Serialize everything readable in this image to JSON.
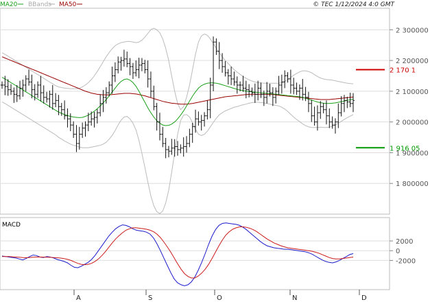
{
  "header": {
    "legend": [
      {
        "label": "MA20",
        "color": "#1aa01a"
      },
      {
        "label": "BBands",
        "color": "#aaaaaa"
      },
      {
        "label": "MA50",
        "color": "#990000"
      }
    ],
    "copyright": "© TEC 1/12/2024 4:0 GMT"
  },
  "chart_data": [
    {
      "type": "ohlc",
      "title": "",
      "y_ticks": [
        "2 300000",
        "2 200000",
        "2 100000",
        "2 000000",
        "1 900000",
        "1 800000"
      ],
      "y_tick_values": [
        2300,
        2200,
        2100,
        2000,
        1900,
        1800
      ],
      "ylim": [
        1700,
        2370
      ],
      "x_ticks": [
        "A",
        "S",
        "O",
        "N",
        "D"
      ],
      "markers": [
        {
          "label": "2 170 1",
          "value": 2170.1,
          "color": "#cc0000"
        },
        {
          "label": "1 916 05",
          "value": 1916.05,
          "color": "#009900"
        }
      ],
      "series": [
        {
          "name": "MA20",
          "color": "#1aa01a"
        },
        {
          "name": "BBands",
          "color": "#aaaaaa"
        },
        {
          "name": "MA50",
          "color": "#990000"
        }
      ],
      "close": [
        2120,
        2115,
        2105,
        2100,
        2090,
        2085,
        2110,
        2120,
        2140,
        2130,
        2105,
        2090,
        2120,
        2095,
        2080,
        2075,
        2090,
        2060,
        2070,
        2050,
        2040,
        2020,
        2010,
        1990,
        1960,
        1930,
        1960,
        1980,
        1990,
        2000,
        2010,
        2015,
        2030,
        2060,
        2080,
        2095,
        2120,
        2150,
        2170,
        2195,
        2200,
        2205,
        2190,
        2180,
        2160,
        2170,
        2185,
        2190,
        2170,
        2140,
        2100,
        2050,
        2000,
        1960,
        1930,
        1910,
        1905,
        1915,
        1920,
        1910,
        1915,
        1920,
        1930,
        1960,
        1985,
        2010,
        2000,
        2005,
        2020,
        2040,
        2120,
        2260,
        2230,
        2200,
        2180,
        2160,
        2150,
        2140,
        2130,
        2120,
        2120,
        2110,
        2105,
        2100,
        2095,
        2090,
        2110,
        2090,
        2080,
        2100,
        2095,
        2080,
        2100,
        2120,
        2130,
        2150,
        2140,
        2120,
        2110,
        2100,
        2110,
        2090,
        2080,
        2060,
        2020,
        2000,
        2030,
        2050,
        2040,
        2020,
        2000,
        1990,
        2000,
        2030,
        2060,
        2070,
        2065,
        2060,
        2070
      ],
      "ma20": [
        2145,
        2140,
        2134,
        2128,
        2122,
        2116,
        2110,
        2104,
        2098,
        2092,
        2086,
        2080,
        2074,
        2068,
        2062,
        2056,
        2050,
        2044,
        2038,
        2032,
        2028,
        2024,
        2021,
        2018,
        2016,
        2015,
        2014,
        2015,
        2018,
        2022,
        2028,
        2035,
        2043,
        2052,
        2062,
        2073,
        2085,
        2097,
        2110,
        2122,
        2132,
        2138,
        2140,
        2136,
        2128,
        2116,
        2100,
        2082,
        2064,
        2046,
        2030,
        2016,
        2004,
        1996,
        1990,
        1988,
        1989,
        1993,
        2000,
        2010,
        2022,
        2036,
        2052,
        2068,
        2084,
        2098,
        2110,
        2118,
        2123,
        2126,
        2127,
        2127,
        2126,
        2124,
        2121,
        2118,
        2115,
        2112,
        2109,
        2106,
        2104,
        2102,
        2100,
        2099,
        2098,
        2097,
        2096,
        2095,
        2094,
        2093,
        2092,
        2091,
        2090,
        2089,
        2088,
        2087,
        2086,
        2085,
        2084,
        2083,
        2082,
        2080,
        2077,
        2074,
        2071,
        2068,
        2065,
        2063,
        2061,
        2060,
        2060,
        2061,
        2062,
        2064,
        2066,
        2068,
        2070,
        2072,
        2074
      ],
      "ma50": [
        2212,
        2208,
        2204,
        2200,
        2196,
        2192,
        2188,
        2184,
        2180,
        2176,
        2172,
        2168,
        2164,
        2160,
        2156,
        2152,
        2148,
        2144,
        2140,
        2136,
        2132,
        2128,
        2124,
        2120,
        2116,
        2112,
        2108,
        2104,
        2100,
        2097,
        2094,
        2092,
        2090,
        2089,
        2088,
        2088,
        2088,
        2089,
        2090,
        2091,
        2092,
        2093,
        2093,
        2093,
        2092,
        2091,
        2089,
        2087,
        2085,
        2082,
        2079,
        2076,
        2073,
        2070,
        2067,
        2065,
        2063,
        2061,
        2060,
        2059,
        2058,
        2058,
        2058,
        2059,
        2060,
        2062,
        2064,
        2066,
        2068,
        2070,
        2072,
        2074,
        2076,
        2078,
        2080,
        2082,
        2083,
        2084,
        2085,
        2086,
        2087,
        2088,
        2089,
        2090,
        2090,
        2090,
        2090,
        2090,
        2090,
        2090,
        2090,
        2089,
        2088,
        2087,
        2086,
        2085,
        2084,
        2083,
        2082,
        2081,
        2080,
        2079,
        2078,
        2077,
        2076,
        2075,
        2074,
        2073,
        2073,
        2073,
        2073,
        2074,
        2075,
        2076,
        2077,
        2078,
        2079,
        2080,
        2081
      ],
      "bb_upper": [
        2225,
        2220,
        2214,
        2208,
        2202,
        2196,
        2190,
        2184,
        2178,
        2172,
        2166,
        2160,
        2154,
        2148,
        2142,
        2136,
        2130,
        2124,
        2118,
        2114,
        2112,
        2110,
        2109,
        2108,
        2108,
        2108,
        2110,
        2114,
        2120,
        2128,
        2138,
        2150,
        2164,
        2180,
        2196,
        2212,
        2226,
        2238,
        2248,
        2254,
        2258,
        2260,
        2262,
        2262,
        2260,
        2258,
        2260,
        2266,
        2276,
        2288,
        2300,
        2305,
        2300,
        2290,
        2270,
        2240,
        2200,
        2150,
        2100,
        2060,
        2040,
        2050,
        2080,
        2120,
        2170,
        2220,
        2260,
        2280,
        2286,
        2282,
        2270,
        2255,
        2240,
        2225,
        2212,
        2200,
        2190,
        2180,
        2170,
        2162,
        2155,
        2148,
        2142,
        2137,
        2133,
        2130,
        2128,
        2127,
        2126,
        2126,
        2126,
        2126,
        2126,
        2126,
        2128,
        2132,
        2138,
        2145,
        2152,
        2158,
        2163,
        2166,
        2166,
        2164,
        2160,
        2154,
        2148,
        2143,
        2140,
        2138,
        2137,
        2136,
        2134,
        2132,
        2130,
        2128,
        2126,
        2125,
        2124
      ],
      "bb_lower": [
        2065,
        2060,
        2054,
        2048,
        2042,
        2036,
        2030,
        2024,
        2018,
        2012,
        2006,
        2000,
        1994,
        1988,
        1982,
        1976,
        1970,
        1964,
        1958,
        1950,
        1944,
        1938,
        1933,
        1928,
        1924,
        1922,
        1918,
        1916,
        1916,
        1916,
        1918,
        1920,
        1922,
        1924,
        1928,
        1934,
        1944,
        1956,
        1972,
        1990,
        2006,
        2016,
        2018,
        2010,
        1996,
        1974,
        1940,
        1898,
        1852,
        1804,
        1760,
        1727,
        1708,
        1702,
        1710,
        1736,
        1778,
        1836,
        1900,
        1960,
        2004,
        2022,
        2024,
        2016,
        1998,
        1976,
        1960,
        1956,
        1960,
        1970,
        1984,
        1999,
        2012,
        2023,
        2030,
        2036,
        2040,
        2044,
        2048,
        2050,
        2053,
        2056,
        2058,
        2061,
        2063,
        2064,
        2064,
        2063,
        2062,
        2060,
        2058,
        2056,
        2054,
        2052,
        2048,
        2042,
        2034,
        2025,
        2016,
        2008,
        2001,
        1994,
        1988,
        1984,
        1982,
        1982,
        1982,
        1983,
        1982,
        1982,
        1983,
        1986,
        1990,
        1996,
        2002,
        2008,
        2014,
        2019,
        2024
      ]
    },
    {
      "type": "line",
      "title": "MACD",
      "y_ticks": [
        "2000",
        "0",
        "-2000"
      ],
      "y_tick_values": [
        2000,
        0,
        -2000
      ],
      "ylim": [
        -8000,
        6800
      ],
      "series": [
        {
          "name": "MACD",
          "color": "#1a1acc",
          "values": [
            -1100,
            -1200,
            -1300,
            -1400,
            -1500,
            -1700,
            -1900,
            -1600,
            -1200,
            -900,
            -1000,
            -1300,
            -1400,
            -1200,
            -1300,
            -1500,
            -1800,
            -2000,
            -2200,
            -2500,
            -3000,
            -3400,
            -3500,
            -3200,
            -2800,
            -2400,
            -1800,
            -1000,
            0,
            1000,
            2000,
            3000,
            3800,
            4500,
            5000,
            5300,
            5200,
            4900,
            4500,
            4200,
            4100,
            4000,
            3800,
            3400,
            2600,
            1400,
            0,
            -1500,
            -3000,
            -4500,
            -5800,
            -6600,
            -7000,
            -7200,
            -7000,
            -6400,
            -5400,
            -4000,
            -2400,
            -600,
            1300,
            3000,
            4300,
            5200,
            5600,
            5700,
            5600,
            5500,
            5400,
            5200,
            4800,
            4300,
            3700,
            3100,
            2500,
            1900,
            1400,
            1000,
            800,
            600,
            500,
            400,
            300,
            300,
            200,
            100,
            0,
            -100,
            -200,
            -400,
            -700,
            -1100,
            -1500,
            -1900,
            -2200,
            -2400,
            -2500,
            -2300,
            -2000,
            -1600,
            -1200,
            -800,
            -600
          ]
        },
        {
          "name": "Signal",
          "color": "#cc1a1a",
          "values": [
            -1200,
            -1200,
            -1200,
            -1250,
            -1300,
            -1350,
            -1420,
            -1450,
            -1400,
            -1350,
            -1300,
            -1300,
            -1320,
            -1340,
            -1360,
            -1400,
            -1450,
            -1520,
            -1620,
            -1780,
            -2000,
            -2300,
            -2600,
            -2800,
            -2900,
            -2800,
            -2600,
            -2200,
            -1700,
            -1000,
            -200,
            700,
            1600,
            2400,
            3100,
            3700,
            4200,
            4500,
            4700,
            4700,
            4600,
            4500,
            4400,
            4200,
            3900,
            3400,
            2700,
            1800,
            800,
            -300,
            -1500,
            -2700,
            -3800,
            -4700,
            -5300,
            -5600,
            -5600,
            -5200,
            -4600,
            -3800,
            -2800,
            -1600,
            -300,
            1000,
            2200,
            3200,
            3900,
            4400,
            4700,
            4900,
            4900,
            4800,
            4600,
            4300,
            3900,
            3400,
            2900,
            2400,
            2000,
            1600,
            1300,
            1000,
            800,
            600,
            500,
            400,
            300,
            200,
            100,
            0,
            -100,
            -300,
            -500,
            -800,
            -1100,
            -1400,
            -1600,
            -1700,
            -1700,
            -1600,
            -1500,
            -1400,
            -1300
          ]
        }
      ]
    }
  ]
}
